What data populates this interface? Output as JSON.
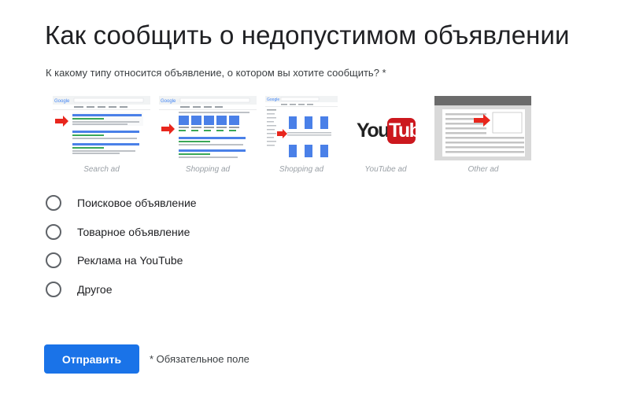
{
  "page": {
    "title": "Как сообщить о недопустимом объявлении",
    "question": "К какому типу относится объявление, о котором вы хотите сообщить? *"
  },
  "thumbnails": [
    {
      "caption": "Search ad",
      "icon": "search-ad-illustration"
    },
    {
      "caption": "Shopping ad",
      "icon": "shopping-ad-illustration"
    },
    {
      "caption": "Shopping ad",
      "icon": "shopping-ad-sidebar-illustration"
    },
    {
      "caption": "YouTube ad",
      "icon": "youtube-logo",
      "logo_text": "YouTube"
    },
    {
      "caption": "Other ad",
      "icon": "other-ad-illustration"
    }
  ],
  "options": [
    {
      "label": "Поисковое объявление",
      "selected": false
    },
    {
      "label": "Товарное объявление",
      "selected": false
    },
    {
      "label": "Реклама на YouTube",
      "selected": false
    },
    {
      "label": "Другое",
      "selected": false
    }
  ],
  "form": {
    "submit_label": "Отправить",
    "required_note": "* Обязательное поле"
  },
  "colors": {
    "primary": "#1a73e8",
    "arrow_red": "#e8261d",
    "youtube_red": "#cc181e",
    "ad_blue": "#4a80e8",
    "ad_green": "#3aa757"
  }
}
